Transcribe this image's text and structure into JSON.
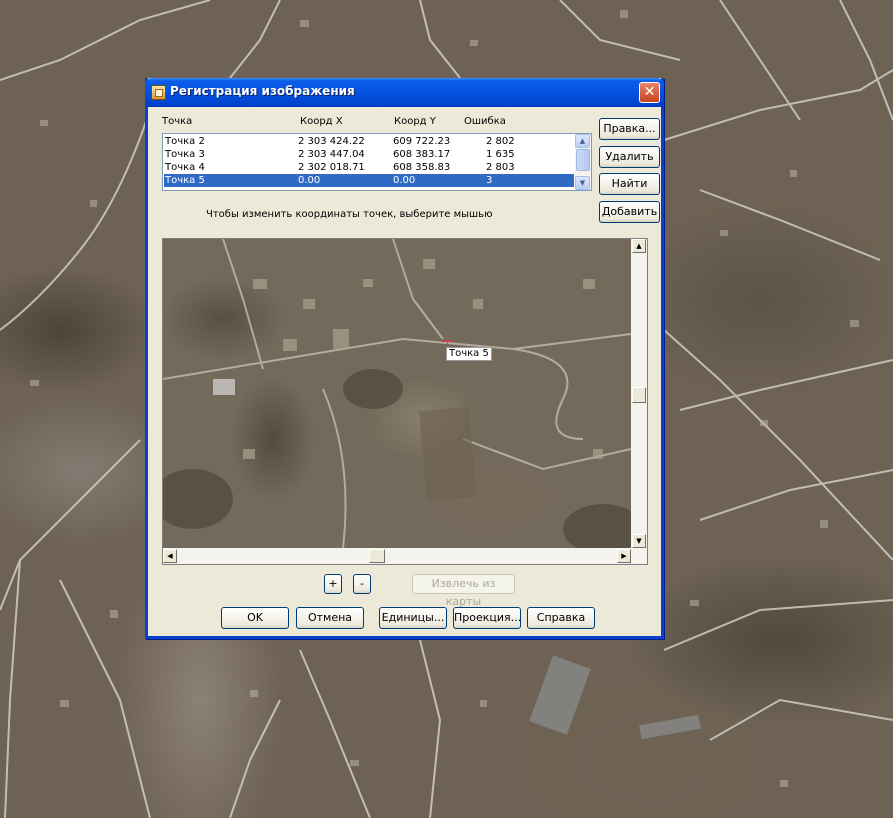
{
  "dialog": {
    "title": "Регистрация изображения",
    "close_glyph": "✕"
  },
  "list": {
    "headers": {
      "point": "Точка",
      "x": "Коорд X",
      "y": "Коорд Y",
      "error": "Ошибка"
    },
    "rows": [
      {
        "point": "Точка 2",
        "x": "2 303 424.22",
        "y": "609 722.23",
        "error": "2 802",
        "selected": false
      },
      {
        "point": "Точка 3",
        "x": "2 303 447.04",
        "y": "608 383.17",
        "error": "1 635",
        "selected": false
      },
      {
        "point": "Точка 4",
        "x": "2 302 018.71",
        "y": "608 358.83",
        "error": "2 803",
        "selected": false
      },
      {
        "point": "Точка 5",
        "x": "0.00",
        "y": "0.00",
        "error": "3",
        "selected": true
      }
    ]
  },
  "side_buttons": {
    "edit": "Правка...",
    "delete": "Удалить",
    "find": "Найти",
    "add": "Добавить"
  },
  "hint": "Чтобы изменить координаты точек, выберите мышью",
  "image": {
    "point_label": "Точка 5"
  },
  "zoom": {
    "plus": "+",
    "minus": "-",
    "extract": "Извлечь из карты"
  },
  "bottom_buttons": {
    "ok": "OK",
    "cancel": "Отмена",
    "units": "Единицы...",
    "projection": "Проекция...",
    "help": "Справка"
  },
  "icons": {
    "title": "app-icon",
    "close": "close-icon",
    "scroll_up": "scroll-up-arrow-icon",
    "scroll_down": "scroll-down-arrow-icon",
    "scroll_left": "scroll-left-arrow-icon",
    "scroll_right": "scroll-right-arrow-icon",
    "cursor": "crosshair-icon"
  }
}
